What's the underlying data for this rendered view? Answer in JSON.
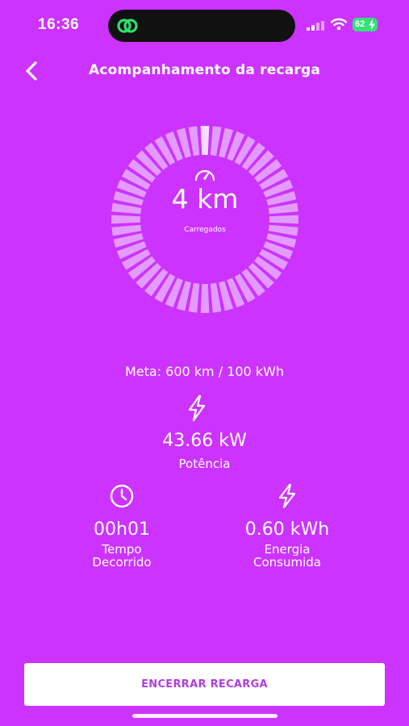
{
  "status_bar": {
    "time": "16:36",
    "battery_level": "62"
  },
  "header": {
    "title": "Acompanhamento da recarga",
    "back_icon": "chevron-left-icon"
  },
  "charge_ring": {
    "segments_total": 48,
    "segments_charged": 1,
    "value": "4 km",
    "label": "Carregados",
    "icon": "gauge-icon"
  },
  "goal": {
    "text": "Meta: 600 km / 100 kWh"
  },
  "power": {
    "icon": "lightning-icon",
    "value": "43.66 kW",
    "label": "Potência"
  },
  "stats": {
    "time": {
      "icon": "clock-icon",
      "value": "00h01",
      "label_line1": "Tempo",
      "label_line2": "Decorrido"
    },
    "energy": {
      "icon": "lightning-icon",
      "value": "0.60 kWh",
      "label_line1": "Energia",
      "label_line2": "Consumida"
    }
  },
  "actions": {
    "end_charge_label": "ENCERRAR RECARGA"
  },
  "colors": {
    "background": "#cc33ff",
    "button_text": "#b13ee0",
    "segment_idle": "#e39bff",
    "segment_active": "#f6ddff",
    "battery": "#35e07a"
  }
}
